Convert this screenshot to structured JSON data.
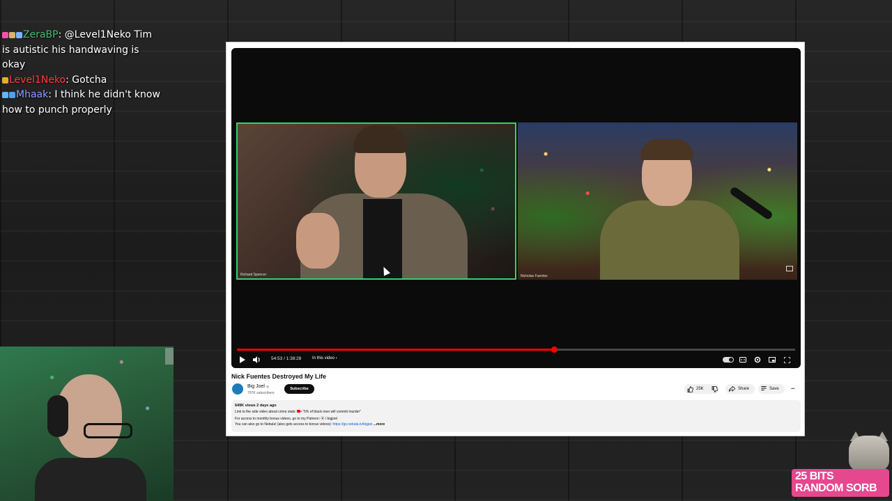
{
  "chat": {
    "messages": [
      {
        "user": "ZeraBP",
        "user_color": "#3fbf6f",
        "text": ": @Level1Neko Tim is autistic his handwaving is okay",
        "badges": [
          "#ff4fa8",
          "#d8b36a",
          "#7fb2ff"
        ]
      },
      {
        "user": "Level1Neko",
        "user_color": "#ff3b3b",
        "text": ": Gotcha",
        "badges": [
          "#e0b02a"
        ]
      },
      {
        "user": "Mhaak",
        "user_color": "#8f9cff",
        "text": ": I think he didn't know how to punch properly",
        "badges": [
          "#59b9ff",
          "#4a9fff"
        ]
      }
    ]
  },
  "player": {
    "left_name": "Richard Spencer",
    "right_name": "Nicholas Fuentes",
    "time": "54:53 / 1:38:28",
    "in_video_label": "In this video ›",
    "progress": 0.568
  },
  "video": {
    "title": "Nick Fuentes Destroyed My Life",
    "channel": "Big Joel",
    "verified_mark": "◎",
    "subs": "797K subscribers",
    "subscribe": "Subscribe",
    "likes": "25K",
    "share": "Share",
    "save": "Save",
    "more": "•••"
  },
  "description": {
    "meta": "649K views  2 days ago",
    "line1_prefix": "Link to the side video about crime stats: ",
    "line1_link": "• \"5% of black men will commit murder\"",
    "line2": "For access to monthly bonus videos, go to my Patreon:  ⦿ / bigjoel",
    "line3_prefix": "You can also go to Nebula! (also gets access to bonus videos): ",
    "line3_link": "https://go.nebula.tv/bigjoe",
    "line3_more": "  ...more"
  },
  "overlay": {
    "bits_line1": "25 BITS",
    "bits_line2": "RANDOM SORB"
  },
  "icons": [
    "play-icon",
    "volume-icon",
    "autoplay-toggle",
    "captions-icon",
    "settings-icon",
    "miniplayer-icon",
    "fullscreen-icon",
    "like-icon",
    "dislike-icon",
    "share-icon",
    "save-icon"
  ]
}
